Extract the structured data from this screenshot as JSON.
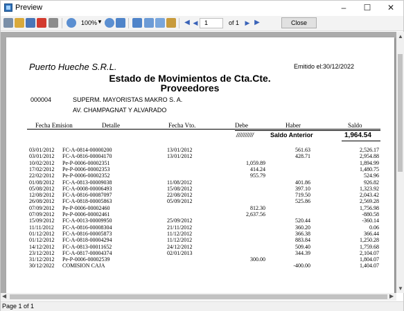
{
  "window": {
    "title": "Preview",
    "minimize": "–",
    "maximize": "☐",
    "close": "✕"
  },
  "toolbar": {
    "zoom": "100%",
    "page_input": "1",
    "page_of": "of 1",
    "close_label": "Close"
  },
  "status": {
    "page_text": "Page 1 of 1"
  },
  "report": {
    "company": "Puerto Hueche S.R.L.",
    "emitido": "Emitido el:30/12/2022",
    "title_line1": "Estado de Movimientos de Cta.Cte.",
    "title_line2": "Proveedores",
    "account_code": "000004",
    "account_name": "SUPERM. MAYORISTAS MAKRO S. A.",
    "account_address": "AV. CHAMPAGNAT Y ALVARADO",
    "headers": {
      "fecha": "Fecha Emision",
      "detalle": "Detalle",
      "vencimiento": "Fecha Vto.",
      "debe": "Debe",
      "haber": "Haber",
      "saldo": "Saldo"
    },
    "saldo_anterior": {
      "marks": "//////////",
      "label": "Saldo Anterior",
      "value": "1,964.54"
    },
    "rows": [
      {
        "fecha": "03/01/2012",
        "detalle": "FC-A-0814-00000200",
        "venc": "13/01/2012",
        "debe": "",
        "haber": "561.63",
        "saldo": "2,526.17"
      },
      {
        "fecha": "03/01/2012",
        "detalle": "FC-A-0816-00004170",
        "venc": "13/01/2012",
        "debe": "",
        "haber": "428.71",
        "saldo": "2,954.88"
      },
      {
        "fecha": "10/02/2012",
        "detalle": "Pe-P-0006-00002351",
        "venc": "",
        "debe": "1,059.89",
        "haber": "",
        "saldo": "1,894.99"
      },
      {
        "fecha": "17/02/2012",
        "detalle": "Pe-P-0006-00002353",
        "venc": "",
        "debe": "414.24",
        "haber": "",
        "saldo": "1,480.75"
      },
      {
        "fecha": "22/02/2012",
        "detalle": "Pe-P-0006-00002352",
        "venc": "",
        "debe": "955.79",
        "haber": "",
        "saldo": "524.96"
      },
      {
        "fecha": "01/08/2012",
        "detalle": "FC-A-0813-00009038",
        "venc": "11/08/2012",
        "debe": "",
        "haber": "401.86",
        "saldo": "926.82"
      },
      {
        "fecha": "05/08/2012",
        "detalle": "FC-A-0008-00006493",
        "venc": "15/08/2012",
        "debe": "",
        "haber": "397.10",
        "saldo": "1,323.92"
      },
      {
        "fecha": "12/08/2012",
        "detalle": "FC-A-0816-00087097",
        "venc": "22/08/2012",
        "debe": "",
        "haber": "719.50",
        "saldo": "2,043.42"
      },
      {
        "fecha": "26/08/2012",
        "detalle": "FC-A-0818-00005863",
        "venc": "05/09/2012",
        "debe": "",
        "haber": "525.86",
        "saldo": "2,569.28"
      },
      {
        "fecha": "07/09/2012",
        "detalle": "Pe-P-0006-00002460",
        "venc": "",
        "debe": "812.30",
        "haber": "",
        "saldo": "1,756.98"
      },
      {
        "fecha": "07/09/2012",
        "detalle": "Pe-P-0006-00002461",
        "venc": "",
        "debe": "2,637.56",
        "haber": "",
        "saldo": "-880.58"
      },
      {
        "fecha": "15/09/2012",
        "detalle": "FC-A-0013-00009950",
        "venc": "25/09/2012",
        "debe": "",
        "haber": "520.44",
        "saldo": "-360.14"
      },
      {
        "fecha": "11/11/2012",
        "detalle": "FC-A-0816-00008304",
        "venc": "21/11/2012",
        "debe": "",
        "haber": "360.20",
        "saldo": "0.06"
      },
      {
        "fecha": "01/12/2012",
        "detalle": "FC-A-0816-00005873",
        "venc": "11/12/2012",
        "debe": "",
        "haber": "366.38",
        "saldo": "366.44"
      },
      {
        "fecha": "01/12/2012",
        "detalle": "FC-A-0818-00004294",
        "venc": "11/12/2012",
        "debe": "",
        "haber": "883.84",
        "saldo": "1,250.28"
      },
      {
        "fecha": "14/12/2012",
        "detalle": "FC-A-0813-00011652",
        "venc": "24/12/2012",
        "debe": "",
        "haber": "509.40",
        "saldo": "1,759.68"
      },
      {
        "fecha": "23/12/2012",
        "detalle": "FC-A-0817-00004374",
        "venc": "02/01/2013",
        "debe": "",
        "haber": "344.39",
        "saldo": "2,104.07"
      },
      {
        "fecha": "31/12/2012",
        "detalle": "Pe-P-0006-00002539",
        "venc": "",
        "debe": "300.00",
        "haber": "",
        "saldo": "1,804.07"
      },
      {
        "fecha": "30/12/2022",
        "detalle": "COMISION CAJA",
        "venc": "",
        "debe": "",
        "haber": "-400.00",
        "saldo": "1,404.07"
      }
    ]
  }
}
